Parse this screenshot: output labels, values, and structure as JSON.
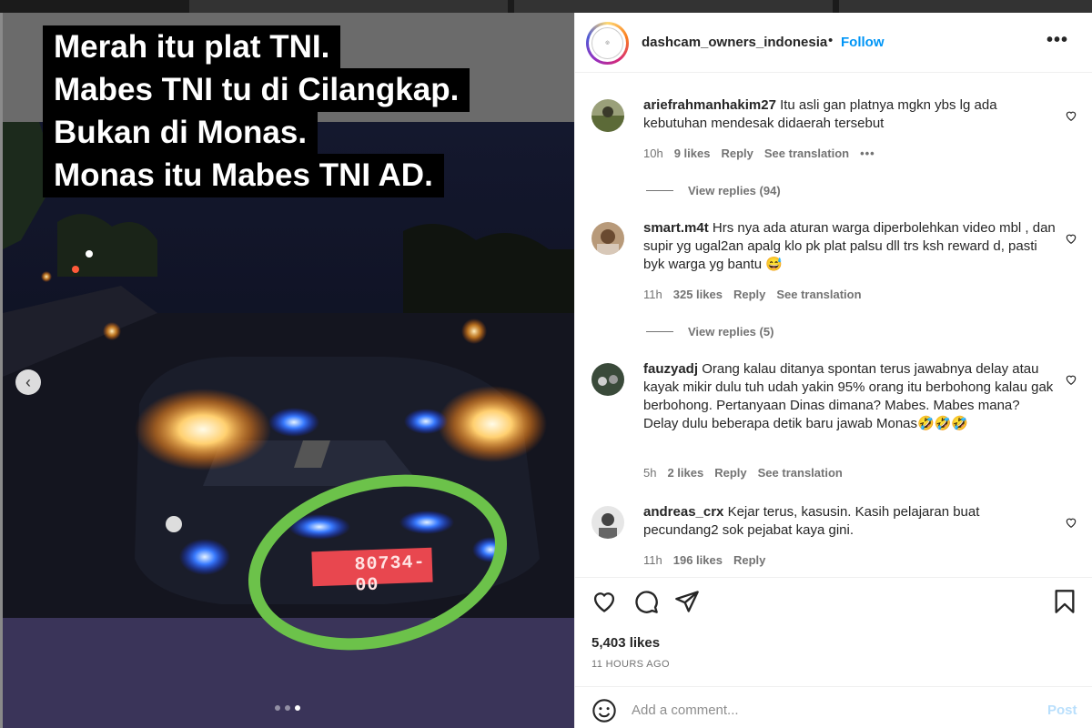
{
  "post": {
    "caption_lines": [
      "Merah itu plat TNI.",
      "Mabes TNI tu di Cilangkap.",
      "Bukan di Monas.",
      "Monas itu Mabes TNI AD."
    ],
    "plate_number": "80734-00",
    "carousel": {
      "total": 3,
      "active_index": 3
    }
  },
  "header": {
    "username": "dashcam_owners_indonesia",
    "separator": "•",
    "follow_label": "Follow",
    "more_icon": "more-horizontal-icon"
  },
  "comments": [
    {
      "username": "ariefrahmanhakim27",
      "text": "Itu asli gan platnya mgkn ybs lg ada kebutuhan mendesak didaerah tersebut",
      "time": "10h",
      "likes": "9 likes",
      "reply_label": "Reply",
      "translate_label": "See translation",
      "more": "•••",
      "view_replies": "View replies (94)"
    },
    {
      "username": "smart.m4t",
      "text": "Hrs nya ada aturan warga diperbolehkan video mbl , dan supir yg ugal2an apalg klo pk plat palsu dll trs ksh reward d, pasti byk warga yg bantu 😅",
      "time": "11h",
      "likes": "325 likes",
      "reply_label": "Reply",
      "translate_label": "See translation",
      "view_replies": "View replies (5)"
    },
    {
      "username": "fauzyadj",
      "text": "Orang kalau ditanya spontan terus jawabnya delay atau kayak mikir dulu tuh udah yakin 95% orang itu berbohong kalau gak berbohong. Pertanyaan Dinas dimana? Mabes. Mabes mana? Delay dulu beberapa detik baru jawab Monas🤣🤣🤣",
      "time": "5h",
      "likes": "2 likes",
      "reply_label": "Reply",
      "translate_label": "See translation"
    },
    {
      "username": "andreas_crx",
      "text": "Kejar terus, kasusin. Kasih pelajaran buat pecundang2 sok pejabat kaya gini.",
      "time": "11h",
      "likes": "196 likes",
      "reply_label": "Reply"
    }
  ],
  "actions": {
    "like_icon": "heart-icon",
    "comment_icon": "comment-bubble-icon",
    "share_icon": "paper-plane-icon",
    "save_icon": "bookmark-icon",
    "likes_count": "5,403 likes",
    "time_ago": "11 HOURS AGO"
  },
  "add_comment": {
    "emoji_icon": "smiley-icon",
    "placeholder": "Add a comment...",
    "post_label": "Post"
  },
  "colors": {
    "link_blue": "#0095f6",
    "post_disabled": "#b9dffc",
    "plate_red": "#e8474f",
    "circle_green": "#6cc24a"
  }
}
